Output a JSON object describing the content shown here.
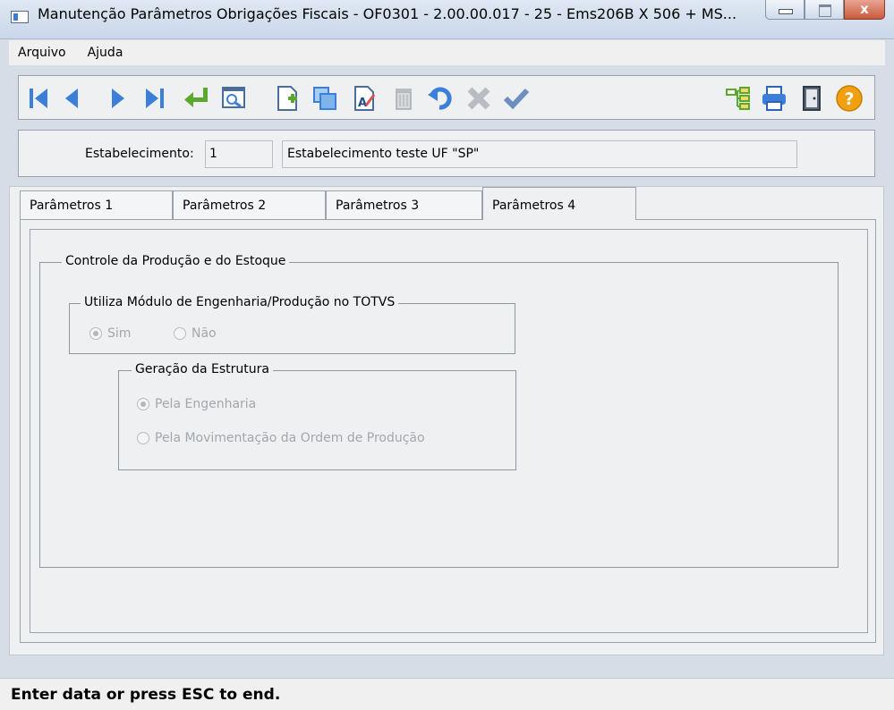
{
  "window": {
    "title": "Manutenção Parâmetros Obrigações Fiscais - OF0301 - 2.00.00.017 - 25 - Ems206B X 506 + MS..."
  },
  "menu": [
    {
      "label": "Arquivo"
    },
    {
      "label": "Ajuda"
    }
  ],
  "toolbar": {
    "icons": [
      "first-record-icon",
      "previous-record-icon",
      "next-record-icon",
      "last-record-icon",
      "goto-icon",
      "search-icon",
      "new-record-icon",
      "copy-record-icon",
      "edit-record-icon",
      "delete-record-icon",
      "undo-icon",
      "cancel-icon",
      "confirm-icon",
      "tree-view-icon",
      "print-icon",
      "exit-icon",
      "help-icon"
    ]
  },
  "estabelecimento": {
    "label": "Estabelecimento:",
    "code": "1",
    "name": "Estabelecimento teste UF \"SP\""
  },
  "tabs": [
    {
      "label": "Parâmetros 1"
    },
    {
      "label": "Parâmetros 2"
    },
    {
      "label": "Parâmetros 3"
    },
    {
      "label": "Parâmetros 4"
    }
  ],
  "active_tab": "Parâmetros 4",
  "content": {
    "group_controle": "Controle da Produção e do Estoque",
    "group_modulo": "Utiliza Módulo de Engenharia/Produção no TOTVS",
    "opt_sim": "Sim",
    "opt_nao": "Não",
    "modulo_selected": "Sim",
    "group_geracao": "Geração da Estrutura",
    "opt_engenharia": "Pela Engenharia",
    "opt_movimentacao": "Pela Movimentação da Ordem de Produção",
    "geracao_selected": "Pela Engenharia"
  },
  "status": {
    "message": "Enter data or press ESC to end."
  },
  "colors": {
    "nav_blue": "#3b7fd8",
    "goto_green": "#5aa82c",
    "help_orange": "#f0a010",
    "disabled_gray": "#a3a7ac"
  }
}
